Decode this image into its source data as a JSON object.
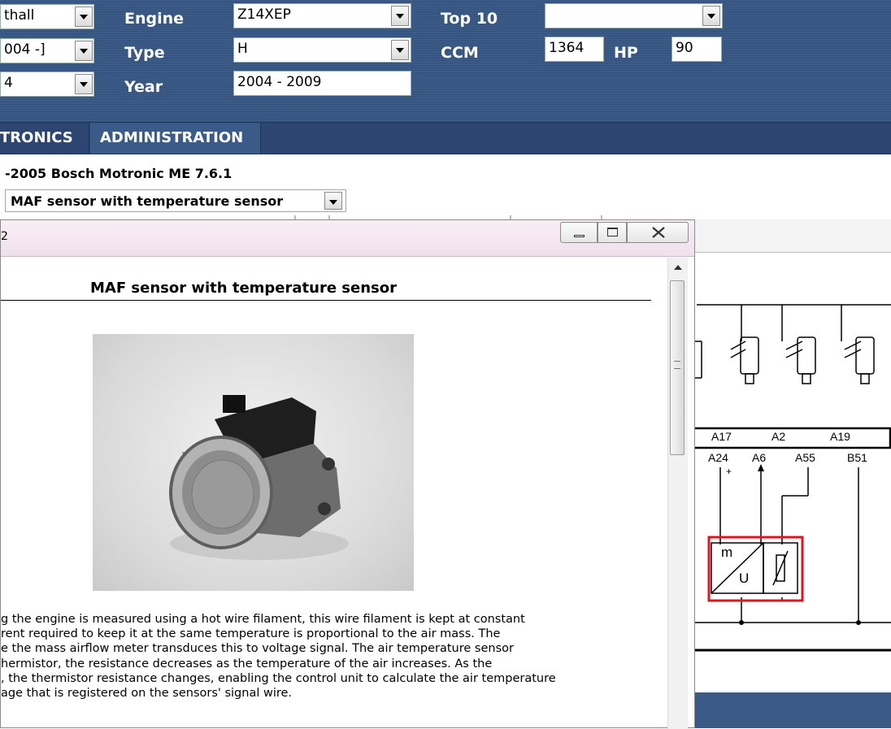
{
  "header": {
    "engine_label": "Engine",
    "type_label": "Type",
    "year_label": "Year",
    "top10_label": "Top 10",
    "ccm_label": "CCM",
    "hp_label": "HP",
    "make_value": "thall",
    "model_value": "004 -]",
    "row3_value": "4",
    "engine_value": "Z14XEP",
    "type_value": "H",
    "year_value": "2004 - 2009",
    "top10_value": "",
    "ccm_value": "1364",
    "hp_value": "90"
  },
  "nav": {
    "tab1": "TRONICS",
    "tab2": "ADMINISTRATION"
  },
  "system_title": "-2005 Bosch Motronic ME 7.6.1",
  "component_select": "MAF sensor with temperature sensor",
  "dialog": {
    "title_fragment": "2",
    "heading": "MAF sensor with temperature sensor",
    "description_lines": [
      "g the engine is measured using a hot wire filament, this wire filament is kept at constant",
      "rent required to keep it at the same temperature is proportional to the air mass. The",
      "e the mass airflow meter transduces this to voltage signal. The air temperature sensor",
      "hermistor, the resistance decreases as the temperature of the air increases. As the",
      ", the thermistor resistance changes, enabling the control unit to calculate the air temperature",
      "age that is registered on the sensors' signal wire."
    ]
  },
  "diagram": {
    "pins_top": [
      "A17",
      "A2",
      "A19"
    ],
    "pins_bottom": [
      "A24",
      "A6",
      "A55",
      "B51"
    ],
    "plus_sign": "+",
    "sensor_m": "m",
    "sensor_u": "U"
  },
  "colors": {
    "header_bg": "#3b5b87",
    "nav_bg": "#2c4671",
    "highlight_box": "#e0141e"
  }
}
